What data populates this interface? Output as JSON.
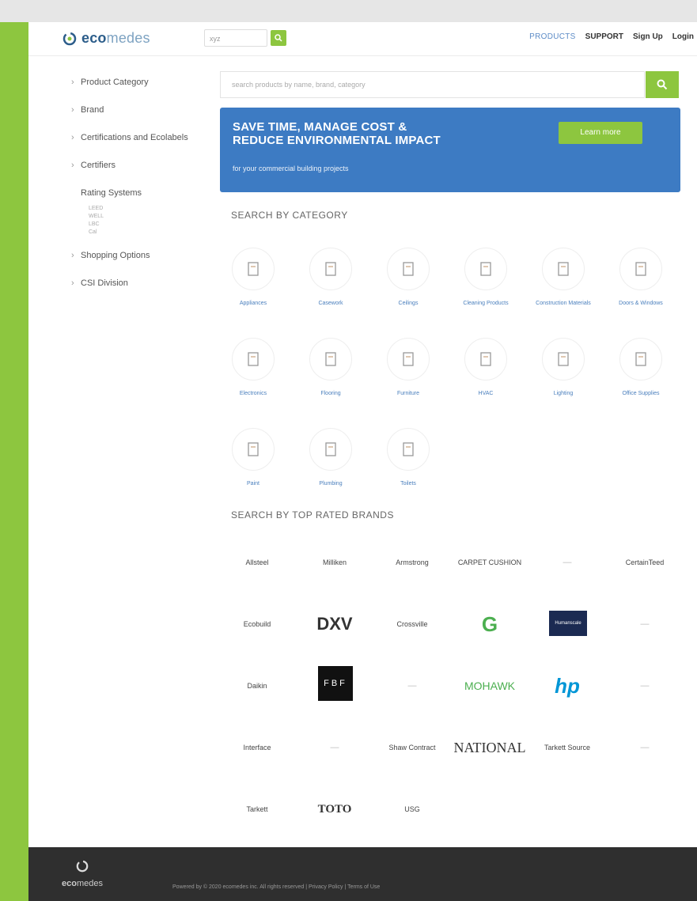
{
  "header": {
    "logo_bold": "eco",
    "logo_light": "medes",
    "search_value": "xyz",
    "nav": [
      "PRODUCTS",
      "SUPPORT",
      "Sign Up",
      "Login"
    ]
  },
  "sidebar": {
    "items": [
      {
        "label": "Product Category"
      },
      {
        "label": "Brand"
      },
      {
        "label": "Certifications and Ecolabels"
      },
      {
        "label": "Certifiers"
      },
      {
        "label": "Rating Systems"
      },
      {
        "label": "Shopping Options"
      },
      {
        "label": "CSI Division"
      }
    ],
    "rating_sub": [
      "LEED",
      "WELL",
      "LBC",
      "Cal"
    ]
  },
  "main": {
    "search_placeholder": "search products by name, brand, category",
    "banner": {
      "title_line1": "SAVE TIME, MANAGE COST &",
      "title_line2": "REDUCE ENVIRONMENTAL IMPACT",
      "subtitle": "for your commercial building projects",
      "button": "Learn more"
    },
    "category_title": "SEARCH BY CATEGORY",
    "categories": [
      {
        "label": "Appliances"
      },
      {
        "label": "Casework"
      },
      {
        "label": "Ceilings"
      },
      {
        "label": "Cleaning Products"
      },
      {
        "label": "Construction Materials"
      },
      {
        "label": "Doors & Windows"
      },
      {
        "label": "Electronics"
      },
      {
        "label": "Flooring"
      },
      {
        "label": "Furniture"
      },
      {
        "label": "HVAC"
      },
      {
        "label": "Lighting"
      },
      {
        "label": "Office Supplies"
      },
      {
        "label": "Paint"
      },
      {
        "label": "Plumbing"
      },
      {
        "label": "Toilets"
      }
    ],
    "brands_title": "SEARCH BY TOP RATED BRANDS",
    "brands": [
      "Allsteel",
      "Milliken",
      "Armstrong",
      "CARPET CUSHION",
      "—",
      "CertainTeed",
      "Ecobuild",
      "DXV",
      "Crossville",
      "G",
      "Humanscale",
      "—",
      "Daikin",
      "FBF",
      "—",
      "MOHAWK",
      "hp",
      "—",
      "Interface",
      "—",
      "Shaw Contract",
      "NATIONAL",
      "Tarkett Source",
      "—",
      "Tarkett",
      "TOTO",
      "USG"
    ]
  },
  "footer": {
    "logo_bold": "eco",
    "logo_light": "medes",
    "copyright": "Powered by © 2020 ecomedes inc. All rights reserved | Privacy Policy | Terms of Use"
  },
  "colors": {
    "accent_green": "#8dc63f",
    "banner_blue": "#3d7bc3",
    "footer_dark": "#2f2f2f"
  }
}
